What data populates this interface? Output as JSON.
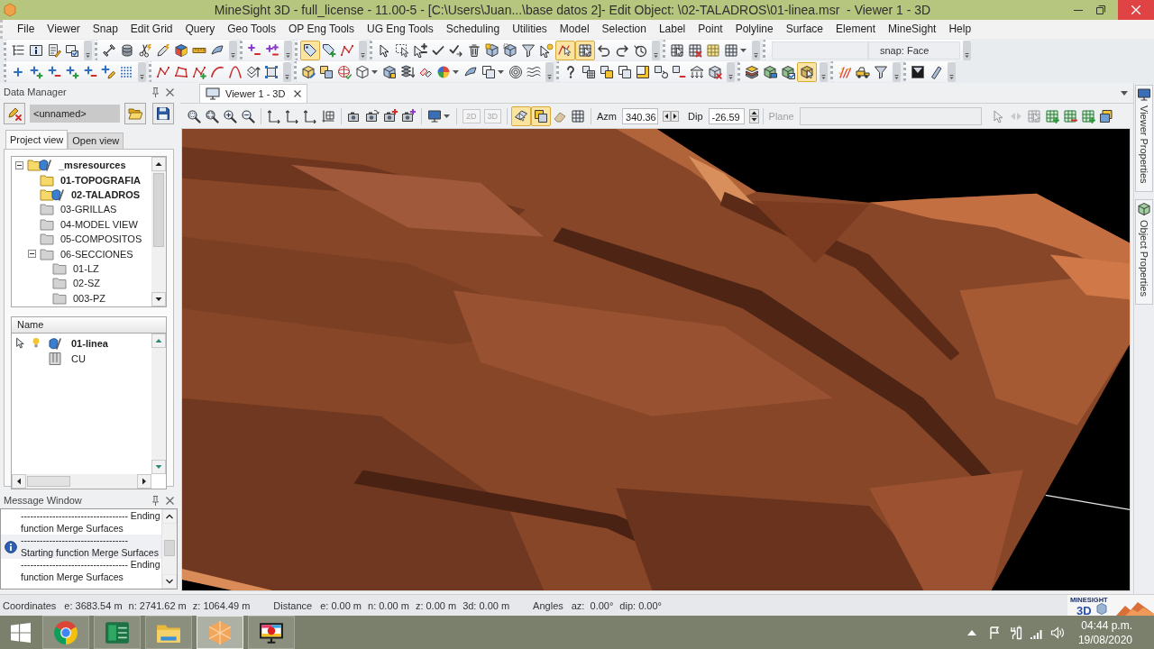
{
  "window": {
    "title": "MineSight 3D - full_license - 11.00-5 - [C:\\Users\\Juan...\\base datos 2]- Edit Object: \\02-TALADROS\\01-linea.msr  - Viewer 1 - 3D"
  },
  "menu": [
    "File",
    "Viewer",
    "Snap",
    "Edit Grid",
    "Query",
    "Geo Tools",
    "OP Eng Tools",
    "UG Eng Tools",
    "Scheduling",
    "Utilities",
    "Model",
    "Selection",
    "Label",
    "Point",
    "Polyline",
    "Surface",
    "Element",
    "MineSight",
    "Help"
  ],
  "toolbars": [
    {
      "groups": [
        {
          "buttons": [
            {
              "pressed": false
            },
            {
              "pressed": false
            },
            {
              "pressed": false
            },
            {
              "pressed": false
            }
          ]
        },
        {
          "buttons": [
            {
              "pressed": false
            },
            {
              "pressed": false
            },
            {
              "pressed": false
            },
            {
              "pressed": false
            },
            {
              "pressed": false
            },
            {
              "pressed": false
            },
            {
              "pressed": false
            }
          ]
        },
        {
          "buttons": [
            {
              "pressed": false
            },
            {
              "pressed": false
            }
          ]
        },
        {
          "buttons": [
            {
              "pressed": true
            },
            {
              "pressed": false
            },
            {
              "pressed": false
            }
          ]
        },
        {
          "buttons": [
            {
              "pressed": false
            },
            {
              "pressed": false
            },
            {
              "pressed": false
            },
            {
              "pressed": false
            },
            {
              "pressed": false
            },
            {
              "pressed": false
            },
            {
              "pressed": false
            },
            {
              "pressed": false
            },
            {
              "pressed": false
            },
            {
              "pressed": false
            },
            {
              "pressed": true
            },
            {
              "pressed": true
            },
            {
              "pressed": false
            },
            {
              "pressed": false
            },
            {
              "pressed": false
            }
          ]
        },
        {
          "buttons": [
            {
              "pressed": false
            },
            {
              "pressed": false
            },
            {
              "pressed": false
            },
            {
              "pressed": false
            }
          ]
        }
      ],
      "snap": {
        "value": "snap: Face"
      }
    },
    {
      "groups": [
        {
          "buttons": [
            {
              "pressed": false
            },
            {
              "pressed": false
            },
            {
              "pressed": false
            },
            {
              "pressed": false
            },
            {
              "pressed": false
            },
            {
              "pressed": false
            },
            {
              "pressed": false
            }
          ]
        },
        {
          "buttons": [
            {
              "pressed": false
            },
            {
              "pressed": false
            },
            {
              "pressed": false
            },
            {
              "pressed": false
            },
            {
              "pressed": false
            },
            {
              "pressed": false
            },
            {
              "pressed": false
            }
          ]
        },
        {
          "buttons": [
            {
              "pressed": false
            },
            {
              "pressed": false
            },
            {
              "pressed": false
            },
            {
              "pressed": false
            },
            {
              "pressed": false
            },
            {
              "pressed": false
            },
            {
              "pressed": false
            },
            {
              "pressed": false
            },
            {
              "pressed": false
            },
            {
              "pressed": false
            },
            {
              "pressed": false
            },
            {
              "pressed": false
            }
          ]
        },
        {
          "buttons": [
            {
              "pressed": false
            },
            {
              "pressed": false
            },
            {
              "pressed": false
            },
            {
              "pressed": false
            },
            {
              "pressed": false
            },
            {
              "pressed": false
            },
            {
              "pressed": false
            },
            {
              "pressed": false
            },
            {
              "pressed": false
            }
          ]
        },
        {
          "buttons": [
            {
              "pressed": false
            },
            {
              "pressed": false
            },
            {
              "pressed": false
            },
            {
              "pressed": true
            }
          ]
        },
        {
          "buttons": [
            {
              "pressed": false
            },
            {
              "pressed": false
            },
            {
              "pressed": false
            }
          ]
        },
        {
          "buttons": [
            {
              "pressed": false
            },
            {
              "pressed": false
            }
          ]
        }
      ]
    }
  ],
  "data_manager": {
    "title": "Data Manager",
    "project_field": {
      "value": "<unnamed>"
    },
    "tabs": [
      {
        "label": "Project view",
        "selected": true
      },
      {
        "label": "Open view",
        "selected": false
      }
    ],
    "tree": [
      {
        "label": "_msresources",
        "open": true,
        "editing": true,
        "expanded": true,
        "children": [
          {
            "label": "01-TOPOGRAFIA",
            "open": true,
            "editing": false
          },
          {
            "label": "02-TALADROS",
            "open": true,
            "editing": true
          },
          {
            "label": "03-GRILLAS",
            "open": false,
            "editing": false
          },
          {
            "label": "04-MODEL VIEW",
            "open": false,
            "editing": false
          },
          {
            "label": "05-COMPOSITOS",
            "open": false,
            "editing": false
          },
          {
            "label": "06-SECCIONES",
            "open": false,
            "editing": false,
            "expanded": true,
            "children": [
              {
                "label": "01-LZ",
                "open": false,
                "editing": false
              },
              {
                "label": "02-SZ",
                "open": false,
                "editing": false
              },
              {
                "label": "003-PZ",
                "open": false,
                "editing": false
              }
            ]
          }
        ]
      }
    ],
    "objects": {
      "column": "Name",
      "items": [
        {
          "label": "01-linea",
          "kind": "geometry",
          "selectable": true,
          "visible": true,
          "editing": true,
          "children": [
            {
              "label": "CU",
              "kind": "grid"
            }
          ]
        }
      ]
    }
  },
  "message_window": {
    "title": "Message Window",
    "messages": [
      {
        "text": "---------------------------------- Ending function Merge Surfaces",
        "kind": "plain",
        "selected": false
      },
      {
        "text": "---------------------------------- Starting function Merge Surfaces",
        "kind": "info",
        "selected": true
      },
      {
        "text": "---------------------------------- Ending function Merge Surfaces",
        "kind": "plain",
        "selected": false
      }
    ]
  },
  "viewer": {
    "tabs": [
      {
        "label": "Viewer 1 - 3D",
        "selected": true
      }
    ],
    "toolbar": {
      "zoom": [
        {
          "pressed": false
        },
        {
          "pressed": false
        },
        {
          "pressed": false
        },
        {
          "pressed": false
        }
      ],
      "axes": [
        {
          "pressed": false
        },
        {
          "pressed": false
        },
        {
          "pressed": false
        },
        {
          "pressed": false
        }
      ],
      "cameras": [
        {
          "pressed": false
        },
        {
          "pressed": false
        },
        {
          "pressed": false
        },
        {
          "pressed": false
        }
      ],
      "display": [
        {
          "pressed": false
        }
      ],
      "view_modes": [
        {
          "label": "2D",
          "disabled": true
        },
        {
          "label": "3D",
          "disabled": true
        }
      ],
      "tools": [
        {
          "pressed": true
        },
        {
          "pressed": true
        },
        {
          "pressed": false
        },
        {
          "pressed": false
        }
      ],
      "azimuth": {
        "label": "Azm",
        "value": "340.36"
      },
      "dip": {
        "label": "Dip",
        "value": "-26.59"
      },
      "plane": {
        "label": "Plane",
        "disabled": true
      },
      "grid_tools": [
        {
          "disabled": true
        },
        {
          "disabled": true
        },
        {
          "disabled": true
        },
        {
          "disabled": false
        },
        {
          "disabled": false
        },
        {
          "disabled": false
        },
        {
          "disabled": false
        }
      ]
    }
  },
  "side_panels": [
    {
      "label": "Viewer Properties"
    },
    {
      "label": "Object Properties"
    }
  ],
  "status_bar": {
    "groups": [
      {
        "label": "Coordinates",
        "values": [
          "e: 3683.54 m",
          "n: 2741.62 m",
          "z: 1064.49 m"
        ]
      },
      {
        "label": "Distance",
        "values": [
          "e: 0.00 m",
          "n: 0.00 m",
          "z: 0.00 m",
          "3d: 0.00 m"
        ]
      },
      {
        "label": "Angles",
        "values": [
          "az:  0.00°",
          "dip: 0.00°"
        ]
      }
    ],
    "logo": {
      "wordmark": "MINESIGHT",
      "mark": "3D"
    }
  },
  "taskbar": {
    "apps": [
      {
        "selected": false
      },
      {
        "selected": false
      },
      {
        "selected": false
      },
      {
        "selected": true
      },
      {
        "selected": false
      }
    ],
    "clock": {
      "time": "04:44 p.m.",
      "date": "19/08/2020"
    }
  }
}
